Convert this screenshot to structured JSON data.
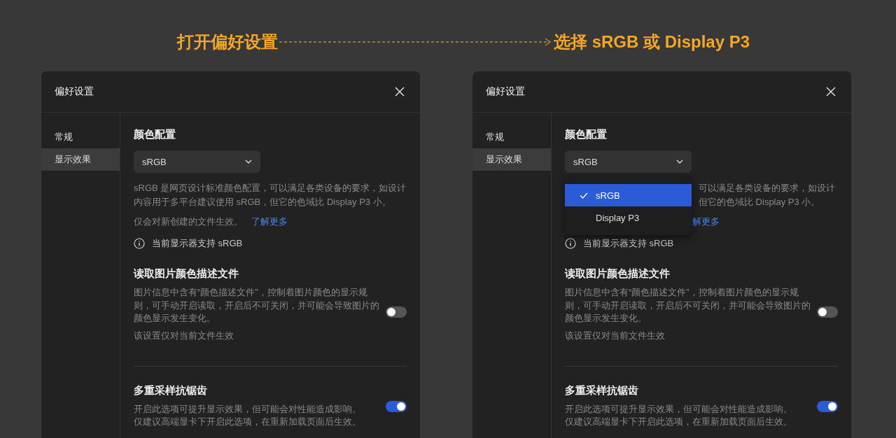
{
  "banner": {
    "step_from": "打开偏好设置",
    "step_to": "选择 sRGB 或 Display P3"
  },
  "panels": [
    {
      "title": "偏好设置",
      "nav": [
        {
          "label": "常规",
          "selected": false
        },
        {
          "label": "显示效果",
          "selected": true
        }
      ],
      "color_profile": {
        "heading": "颜色配置",
        "value": "sRGB",
        "description": [
          "sRGB 是网页设计标准颜色配置，可以满足各类设备的要求，如设计",
          "内容用于多平台建议使用 sRGB，但它的色域比 Display P3 小。"
        ],
        "note": "仅会对新创建的文件生效。",
        "link": "了解更多",
        "support": "当前显示器支持 sRGB"
      },
      "settings": [
        {
          "heading": "读取图片颜色描述文件",
          "description": [
            "图片信息中含有“颜色描述文件”，控制着图片颜色的显示规",
            "则，可手动开启读取，开启后不可关闭，并可能会导致图片的",
            "颜色显示发生变化。"
          ],
          "note": "该设置仅对当前文件生效",
          "on": false
        },
        {
          "heading": "多重采样抗锯齿",
          "description": [
            "开启此选项可提升显示效果，但可能会对性能造成影响。",
            "仅建议高端显卡下开启此选项，在重新加载页面后生效。"
          ],
          "on": true
        }
      ]
    },
    {
      "title": "偏好设置",
      "nav": [
        {
          "label": "常规",
          "selected": false
        },
        {
          "label": "显示效果",
          "selected": true
        }
      ],
      "color_profile": {
        "heading": "颜色配置",
        "value": "sRGB",
        "options": [
          {
            "label": "sRGB",
            "selected": true
          },
          {
            "label": "Display P3",
            "selected": false
          }
        ],
        "description": [
          "可以满足各类设备的要求，如设计",
          "但它的色域比 Display P3 小。"
        ],
        "link": "解更多",
        "support": "当前显示器支持 sRGB"
      },
      "settings": [
        {
          "heading": "读取图片颜色描述文件",
          "description": [
            "图片信息中含有“颜色描述文件”，控制着图片颜色的显示规",
            "则，可手动开启读取，开启后不可关闭，并可能会导致图片的",
            "颜色显示发生变化。"
          ],
          "note": "该设置仅对当前文件生效",
          "on": false
        },
        {
          "heading": "多重采样抗锯齿",
          "description": [
            "开启此选项可提升显示效果，但可能会对性能造成影响。",
            "仅建议高端显卡下开启此选项，在重新加载页面后生效。"
          ],
          "on": true
        }
      ]
    }
  ]
}
